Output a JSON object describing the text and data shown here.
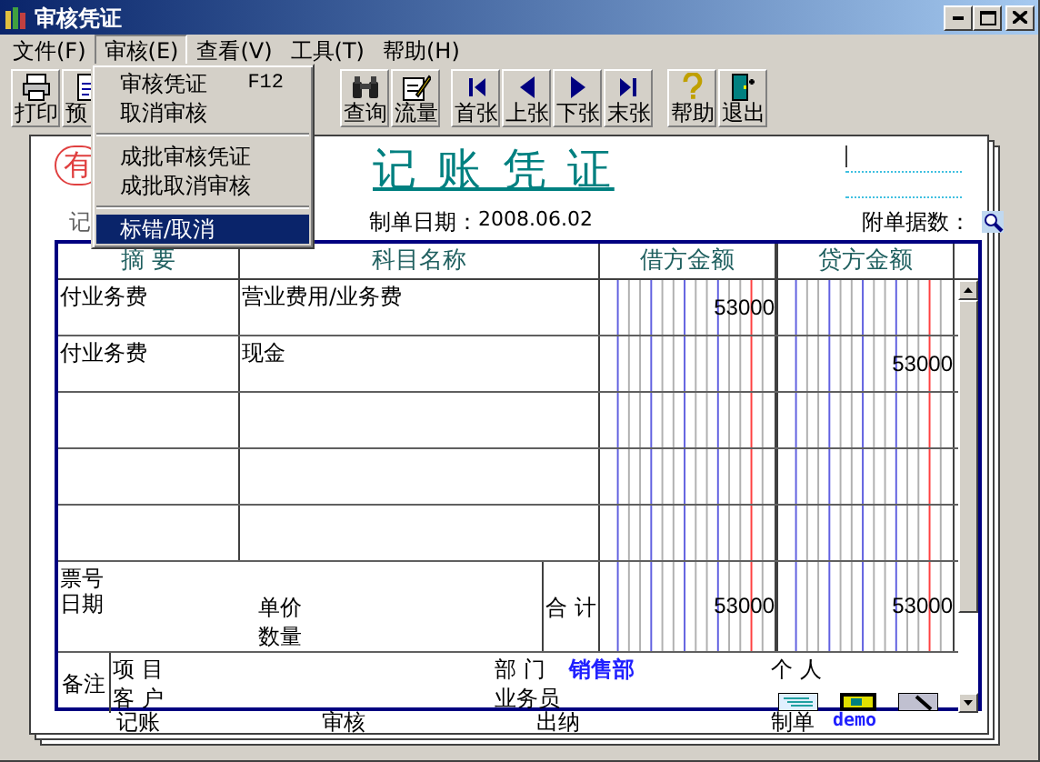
{
  "window": {
    "title": "审核凭证"
  },
  "menu_bar": [
    {
      "label": "文件(F)",
      "selected": false
    },
    {
      "label": "审核(E)",
      "selected": true
    },
    {
      "label": "查看(V)",
      "selected": false
    },
    {
      "label": "工具(T)",
      "selected": false
    },
    {
      "label": "帮助(H)",
      "selected": false
    }
  ],
  "open_menu": {
    "items": [
      {
        "kind": "item",
        "label": "审核凭证",
        "shortcut": "F12",
        "selected": false
      },
      {
        "kind": "item",
        "label": "取消审核",
        "selected": false
      },
      {
        "kind": "separator"
      },
      {
        "kind": "item",
        "label": "成批审核凭证",
        "selected": false
      },
      {
        "kind": "item",
        "label": "成批取消审核",
        "selected": false
      },
      {
        "kind": "separator"
      },
      {
        "kind": "item",
        "label": "标错/取消",
        "selected": true
      }
    ]
  },
  "toolbar": [
    [
      {
        "kind": "printer",
        "label": "打印"
      },
      {
        "kind": "document",
        "label": "预"
      }
    ],
    [
      {
        "kind": "binoculars",
        "label": "查询"
      },
      {
        "kind": "note",
        "label": "流量"
      }
    ],
    [
      {
        "kind": "first",
        "label": "首张"
      },
      {
        "kind": "prev",
        "label": "上张"
      },
      {
        "kind": "next",
        "label": "下张"
      },
      {
        "kind": "last",
        "label": "末张"
      }
    ],
    [
      {
        "kind": "help",
        "label": "帮助"
      },
      {
        "kind": "exit",
        "label": "退出"
      }
    ]
  ],
  "voucher": {
    "stamp": "有",
    "title": "记 账 凭 证",
    "type_label": "记",
    "date_label": "制单日期：",
    "date": "2008.06.02",
    "attachments_label": "附单据数：",
    "columns": [
      "摘 要",
      "科目名称",
      "借方金额",
      "贷方金额"
    ],
    "rows": [
      {
        "summary": "付业务费",
        "account": "营业费用/业务费",
        "debit": "53000"
      },
      {
        "summary": "付业务费",
        "account": "现金",
        "credit": "53000"
      }
    ],
    "totals": {
      "ticket_label": "票号",
      "date_label": "日期",
      "price_label": "单价",
      "quantity_label": "数量",
      "total_label": "合 计",
      "debit": "53000",
      "credit": "53000"
    },
    "notes": {
      "label": "备注",
      "project_label": "项 目",
      "customer_label": "客 户",
      "department_label": "部 门",
      "department": "销售部",
      "salesperson_label": "业务员",
      "individual_label": "个 人"
    },
    "signatures": [
      "记账",
      "审核",
      "出纳",
      "制单"
    ],
    "maker": "demo"
  }
}
